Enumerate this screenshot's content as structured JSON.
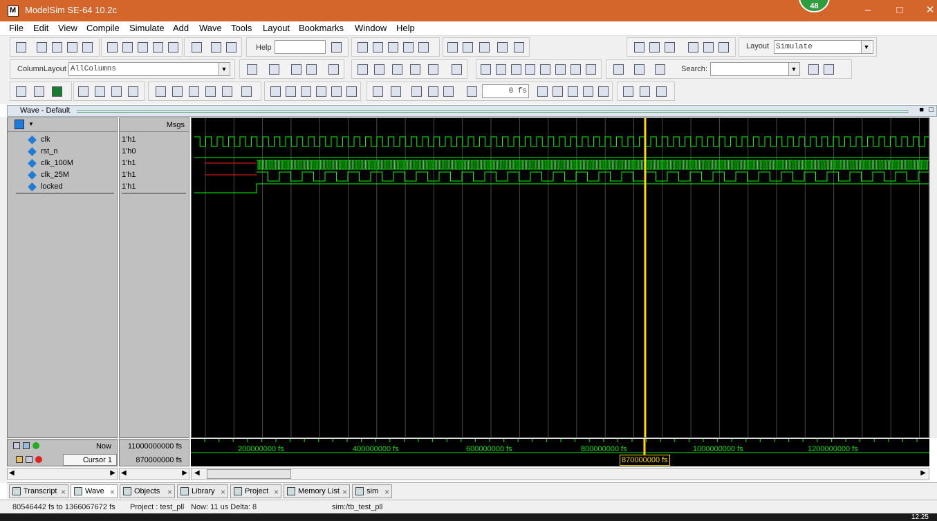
{
  "window": {
    "title": "ModelSim SE-64 10.2c",
    "badge": "48"
  },
  "menu": [
    "File",
    "Edit",
    "View",
    "Compile",
    "Simulate",
    "Add",
    "Wave",
    "Tools",
    "Layout",
    "Bookmarks",
    "Window",
    "Help"
  ],
  "toolbar": {
    "help_label": "Help",
    "layout_label": "Layout",
    "layout_value": "Simulate",
    "column_layout_label": "ColumnLayout",
    "column_layout_value": "AllColumns",
    "search_label": "Search:",
    "time_value": "0",
    "time_unit": "fs"
  },
  "wave_window": {
    "title": "Wave - Default",
    "msgs_header": "Msgs"
  },
  "signals": [
    {
      "name": "clk",
      "value": "1'h1"
    },
    {
      "name": "rst_n",
      "value": "1'h0"
    },
    {
      "name": "clk_100M",
      "value": "1'h1"
    },
    {
      "name": "clk_25M",
      "value": "1'h1"
    },
    {
      "name": "locked",
      "value": "1'h1"
    }
  ],
  "cursor_panel": {
    "now_label": "Now",
    "now_value": "11000000000 fs",
    "cursor_label": "Cursor 1",
    "cursor_value": "870000000 fs",
    "cursor_marker": "870000000 fs"
  },
  "ruler": {
    "labels": [
      "200000000 fs",
      "400000000 fs",
      "600000000 fs",
      "800000000 fs",
      "1000000000 fs",
      "1200000000 fs"
    ]
  },
  "tabs": [
    "Transcript",
    "Wave",
    "Objects",
    "Library",
    "Project",
    "Memory List",
    "sim"
  ],
  "status": {
    "range": "80546442 fs to 1366067672 fs",
    "project": "Project : test_pll",
    "now": "Now: 11 us  Delta: 8",
    "sim": "sim:/tb_test_pll"
  },
  "clock": "12:25",
  "colors": {
    "title_bar": "#d4662b",
    "wave_green": "#00ff00",
    "cursor_yellow": "#ffd800",
    "reset_red": "#ff2020"
  }
}
